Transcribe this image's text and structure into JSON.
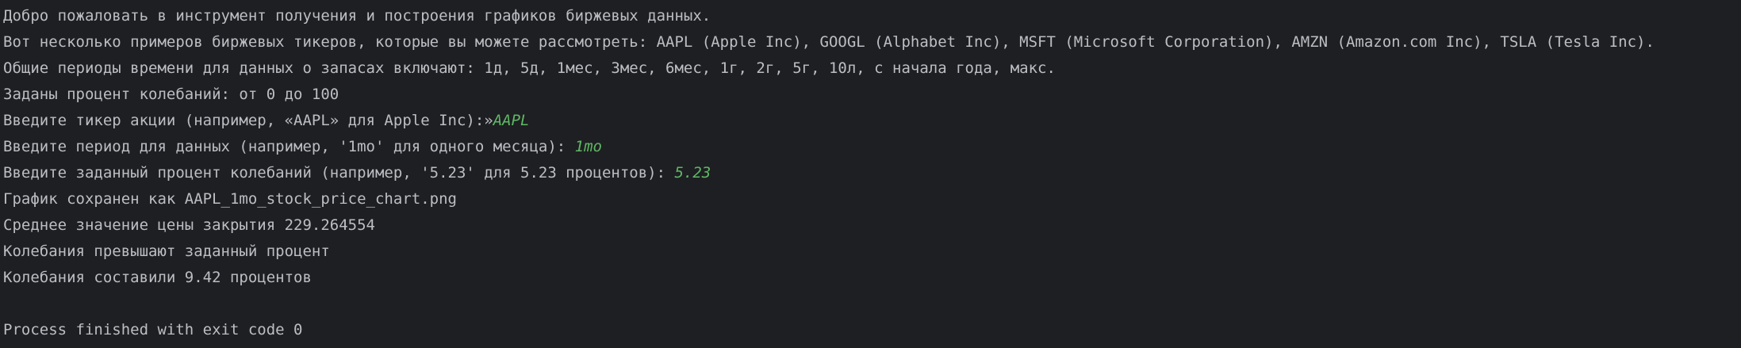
{
  "console": {
    "lines": [
      {
        "text": "Добро пожаловать в инструмент получения и построения графиков биржевых данных."
      },
      {
        "text": "Вот несколько примеров биржевых тикеров, которые вы можете рассмотреть: AAPL (Apple Inc), GOOGL (Alphabet Inc), MSFT (Microsoft Corporation), AMZN (Amazon.com Inc), TSLA (Tesla Inc)."
      },
      {
        "text": "Общие периоды времени для данных о запасах включают: 1д, 5д, 1мес, 3мес, 6мес, 1г, 2г, 5г, 10л, с начала года, макс."
      },
      {
        "text": "Заданы процент колебаний: от 0 до 100"
      },
      {
        "prompt": "Введите тикер акции (например, «AAPL» для Apple Inc):»",
        "input": "AAPL"
      },
      {
        "prompt": "Введите период для данных (например, '1mo' для одного месяца): ",
        "input": "1mo"
      },
      {
        "prompt": "Введите заданный процент колебаний (например, '5.23' для 5.23 процентов): ",
        "input": "5.23"
      },
      {
        "text": "График сохранен как AAPL_1mo_stock_price_chart.png"
      },
      {
        "text": "Среднее значение цены закрытия 229.264554"
      },
      {
        "text": "Колебания превышают заданный процент"
      },
      {
        "text": "Колебания составили 9.42 процентов"
      },
      {
        "text": ""
      },
      {
        "text": "Process finished with exit code 0"
      }
    ]
  },
  "colors": {
    "background": "#1e1f22",
    "text": "#bcbec4",
    "user_input": "#5fb865"
  }
}
